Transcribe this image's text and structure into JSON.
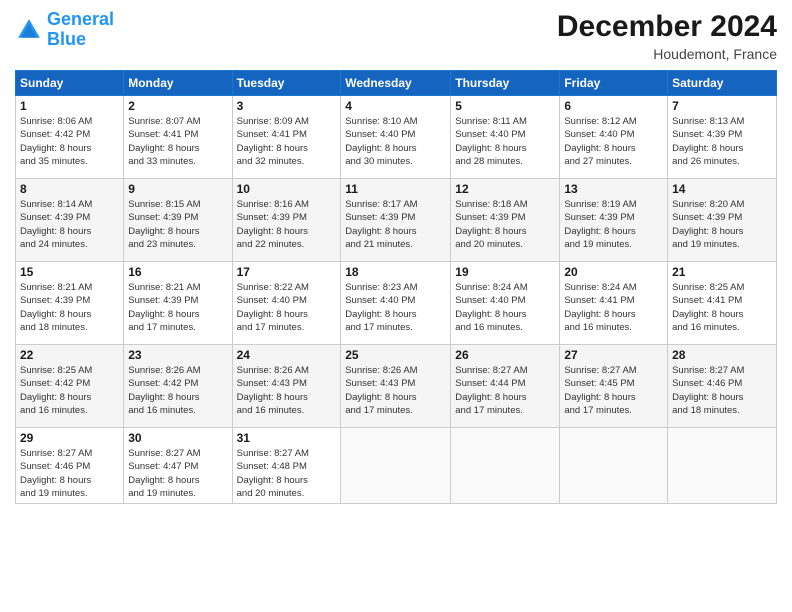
{
  "logo": {
    "line1": "General",
    "line2": "Blue"
  },
  "title": "December 2024",
  "subtitle": "Houdemont, France",
  "weekdays": [
    "Sunday",
    "Monday",
    "Tuesday",
    "Wednesday",
    "Thursday",
    "Friday",
    "Saturday"
  ],
  "weeks": [
    [
      {
        "day": "1",
        "sunrise": "8:06 AM",
        "sunset": "4:42 PM",
        "daylight": "8 hours and 35 minutes."
      },
      {
        "day": "2",
        "sunrise": "8:07 AM",
        "sunset": "4:41 PM",
        "daylight": "8 hours and 33 minutes."
      },
      {
        "day": "3",
        "sunrise": "8:09 AM",
        "sunset": "4:41 PM",
        "daylight": "8 hours and 32 minutes."
      },
      {
        "day": "4",
        "sunrise": "8:10 AM",
        "sunset": "4:40 PM",
        "daylight": "8 hours and 30 minutes."
      },
      {
        "day": "5",
        "sunrise": "8:11 AM",
        "sunset": "4:40 PM",
        "daylight": "8 hours and 28 minutes."
      },
      {
        "day": "6",
        "sunrise": "8:12 AM",
        "sunset": "4:40 PM",
        "daylight": "8 hours and 27 minutes."
      },
      {
        "day": "7",
        "sunrise": "8:13 AM",
        "sunset": "4:39 PM",
        "daylight": "8 hours and 26 minutes."
      }
    ],
    [
      {
        "day": "8",
        "sunrise": "8:14 AM",
        "sunset": "4:39 PM",
        "daylight": "8 hours and 24 minutes."
      },
      {
        "day": "9",
        "sunrise": "8:15 AM",
        "sunset": "4:39 PM",
        "daylight": "8 hours and 23 minutes."
      },
      {
        "day": "10",
        "sunrise": "8:16 AM",
        "sunset": "4:39 PM",
        "daylight": "8 hours and 22 minutes."
      },
      {
        "day": "11",
        "sunrise": "8:17 AM",
        "sunset": "4:39 PM",
        "daylight": "8 hours and 21 minutes."
      },
      {
        "day": "12",
        "sunrise": "8:18 AM",
        "sunset": "4:39 PM",
        "daylight": "8 hours and 20 minutes."
      },
      {
        "day": "13",
        "sunrise": "8:19 AM",
        "sunset": "4:39 PM",
        "daylight": "8 hours and 19 minutes."
      },
      {
        "day": "14",
        "sunrise": "8:20 AM",
        "sunset": "4:39 PM",
        "daylight": "8 hours and 19 minutes."
      }
    ],
    [
      {
        "day": "15",
        "sunrise": "8:21 AM",
        "sunset": "4:39 PM",
        "daylight": "8 hours and 18 minutes."
      },
      {
        "day": "16",
        "sunrise": "8:21 AM",
        "sunset": "4:39 PM",
        "daylight": "8 hours and 17 minutes."
      },
      {
        "day": "17",
        "sunrise": "8:22 AM",
        "sunset": "4:40 PM",
        "daylight": "8 hours and 17 minutes."
      },
      {
        "day": "18",
        "sunrise": "8:23 AM",
        "sunset": "4:40 PM",
        "daylight": "8 hours and 17 minutes."
      },
      {
        "day": "19",
        "sunrise": "8:24 AM",
        "sunset": "4:40 PM",
        "daylight": "8 hours and 16 minutes."
      },
      {
        "day": "20",
        "sunrise": "8:24 AM",
        "sunset": "4:41 PM",
        "daylight": "8 hours and 16 minutes."
      },
      {
        "day": "21",
        "sunrise": "8:25 AM",
        "sunset": "4:41 PM",
        "daylight": "8 hours and 16 minutes."
      }
    ],
    [
      {
        "day": "22",
        "sunrise": "8:25 AM",
        "sunset": "4:42 PM",
        "daylight": "8 hours and 16 minutes."
      },
      {
        "day": "23",
        "sunrise": "8:26 AM",
        "sunset": "4:42 PM",
        "daylight": "8 hours and 16 minutes."
      },
      {
        "day": "24",
        "sunrise": "8:26 AM",
        "sunset": "4:43 PM",
        "daylight": "8 hours and 16 minutes."
      },
      {
        "day": "25",
        "sunrise": "8:26 AM",
        "sunset": "4:43 PM",
        "daylight": "8 hours and 17 minutes."
      },
      {
        "day": "26",
        "sunrise": "8:27 AM",
        "sunset": "4:44 PM",
        "daylight": "8 hours and 17 minutes."
      },
      {
        "day": "27",
        "sunrise": "8:27 AM",
        "sunset": "4:45 PM",
        "daylight": "8 hours and 17 minutes."
      },
      {
        "day": "28",
        "sunrise": "8:27 AM",
        "sunset": "4:46 PM",
        "daylight": "8 hours and 18 minutes."
      }
    ],
    [
      {
        "day": "29",
        "sunrise": "8:27 AM",
        "sunset": "4:46 PM",
        "daylight": "8 hours and 19 minutes."
      },
      {
        "day": "30",
        "sunrise": "8:27 AM",
        "sunset": "4:47 PM",
        "daylight": "8 hours and 19 minutes."
      },
      {
        "day": "31",
        "sunrise": "8:27 AM",
        "sunset": "4:48 PM",
        "daylight": "8 hours and 20 minutes."
      },
      null,
      null,
      null,
      null
    ]
  ],
  "labels": {
    "sunrise": "Sunrise:",
    "sunset": "Sunset:",
    "daylight": "Daylight:"
  }
}
